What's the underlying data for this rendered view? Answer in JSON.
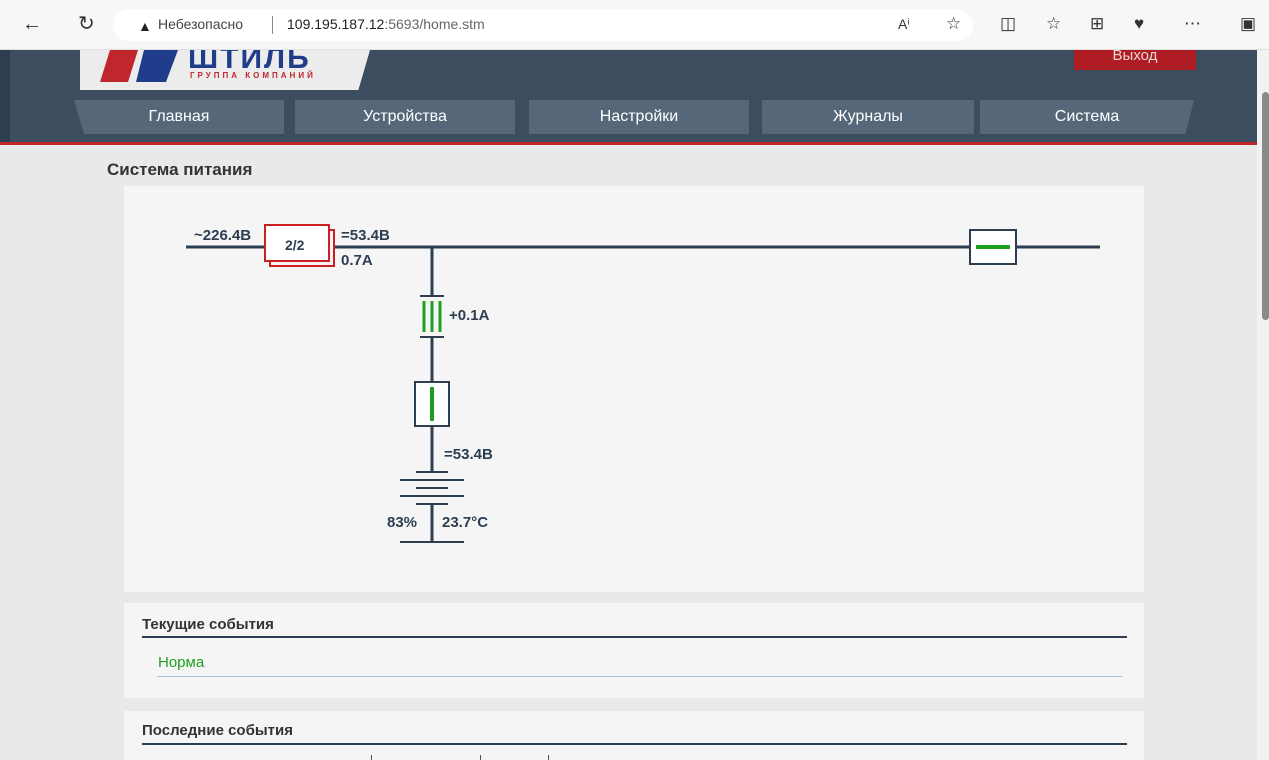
{
  "browser": {
    "security_label": "Небезопасно",
    "url_host": "109.195.187.12",
    "url_rest": ":5693/home.stm"
  },
  "header": {
    "logo_text": "ШТИЛЬ",
    "logo_sub": "ГРУППА КОМПАНИЙ",
    "exit_label": "Выход",
    "menu": [
      {
        "label": "Главная"
      },
      {
        "label": "Устройства"
      },
      {
        "label": "Настройки"
      },
      {
        "label": "Журналы"
      },
      {
        "label": "Система"
      }
    ]
  },
  "power": {
    "title": "Система питания",
    "input_voltage": "~226.4В",
    "rectifiers": "2/2",
    "output_voltage": "=53.4В",
    "output_current": "0.7A",
    "battery_current": "+0.1A",
    "battery_voltage": "=53.4В",
    "battery_charge": "83%",
    "battery_temp": "23.7°C"
  },
  "current_events": {
    "title": "Текущие события",
    "status": "Норма"
  },
  "last_events": {
    "title": "Последние события"
  },
  "colors": {
    "header": "#3b4d5e",
    "accent_red": "#c0272d",
    "ok_green": "#1ea01e",
    "line": "#2c3e50"
  }
}
